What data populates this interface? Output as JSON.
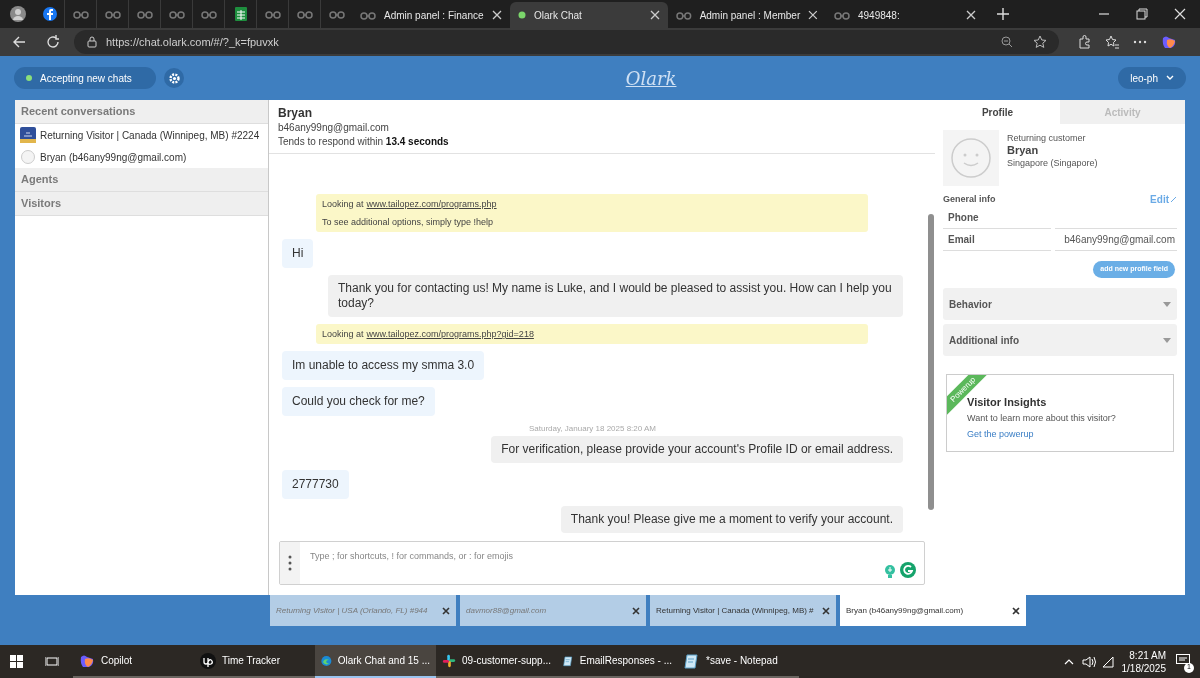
{
  "browser": {
    "tabs": [
      {
        "kind": "icon",
        "selected": false
      },
      {
        "kind": "icon",
        "selected": false
      },
      {
        "kind": "icon",
        "selected": false
      },
      {
        "kind": "icon",
        "selected": false
      },
      {
        "kind": "icon",
        "selected": false
      },
      {
        "kind": "icon",
        "selected": false
      },
      {
        "kind": "icon",
        "selected": false
      },
      {
        "kind": "icon",
        "selected": false
      },
      {
        "kind": "icon",
        "selected": false
      },
      {
        "kind": "icon",
        "selected": false
      },
      {
        "kind": "icon",
        "selected": false
      },
      {
        "kind": "text",
        "title": "Admin panel : Finance",
        "selected": false
      },
      {
        "kind": "text",
        "title": "Olark Chat",
        "selected": true
      },
      {
        "kind": "text",
        "title": "Admin panel : Member",
        "selected": false
      },
      {
        "kind": "text",
        "title": "4949848:",
        "selected": false
      }
    ],
    "url": "https://chat.olark.com/#/?_k=fpuvxk"
  },
  "header": {
    "status": "Accepting new chats",
    "logo": "Olark",
    "user": "leo-ph"
  },
  "sidebar": {
    "sections": [
      {
        "title": "Recent conversations",
        "items": [
          {
            "label": "Returning Visitor | Canada (Winnipeg, MB) #2224",
            "kind": "visitor"
          },
          {
            "label": "Bryan (b46any99ng@gmail.com)",
            "kind": "contact"
          }
        ]
      },
      {
        "title": "Agents"
      },
      {
        "title": "Visitors"
      }
    ]
  },
  "conversation": {
    "name": "Bryan",
    "email": "b46any99ng@gmail.com",
    "response_text": "Tends to respond within",
    "response_time": "13.4 seconds",
    "messages": [
      {
        "kind": "system",
        "lines": [
          {
            "text": "Looking at",
            "link": "www.tailopez.com/programs.php"
          },
          {
            "text": "To see additional options, simply type !help"
          }
        ]
      },
      {
        "kind": "visitor",
        "text": "Hi"
      },
      {
        "kind": "agent",
        "text": "Thank you for contacting us! My name is Luke, and I would be pleased to assist you. How can I help you today?"
      },
      {
        "kind": "system",
        "lines": [
          {
            "text": "Looking at",
            "link": "www.tailopez.com/programs.php?gid=218"
          }
        ]
      },
      {
        "kind": "visitor",
        "text": "Im unable to access my smma 3.0"
      },
      {
        "kind": "visitor",
        "text": "Could you check for me?"
      },
      {
        "kind": "timestamp",
        "text": "Saturday, January 18 2025 8:20 AM"
      },
      {
        "kind": "agent",
        "text": "For verification, please provide your account's Profile ID or email address."
      },
      {
        "kind": "visitor",
        "text": "2777730"
      },
      {
        "kind": "agent",
        "text": "Thank you! Please give me a moment to verify your account."
      }
    ],
    "composer": {
      "placeholder": "Type ; for shortcuts, ! for commands, or : for emojis"
    }
  },
  "profile": {
    "tabs": [
      {
        "label": "Profile",
        "selected": true
      },
      {
        "label": "Activity",
        "selected": false
      }
    ],
    "customer_type": "Returning customer",
    "name": "Bryan",
    "location": "Singapore (Singapore)",
    "general_info": "General info",
    "edit": "Edit",
    "fields": [
      {
        "label": "Phone"
      },
      {
        "label": "Email",
        "value": "b46any99ng@gmail.com"
      }
    ],
    "add_field": "add new profile field",
    "sections": [
      {
        "title": "Behavior",
        "expanded": false
      },
      {
        "title": "Additional info",
        "expanded": false
      }
    ],
    "powerup": {
      "ribbon": "Powerup",
      "title": "Visitor Insights",
      "text": "Want to learn more about this visitor?",
      "link": "Get the powerup"
    }
  },
  "chat_tabs": [
    {
      "label": "Returning Visitor | USA (Orlando, FL) #944",
      "selected": false,
      "italic": true
    },
    {
      "label": "davmor88@gmail.com",
      "selected": false,
      "italic": true
    },
    {
      "label": "Returning Visitor | Canada (Winnipeg, MB) #",
      "selected": false,
      "italic": false
    },
    {
      "label": "Bryan (b46any99ng@gmail.com)",
      "selected": true,
      "italic": false
    }
  ],
  "taskbar": {
    "items": [
      {
        "label": "Copilot",
        "selected": false
      },
      {
        "label": "Time Tracker",
        "selected": false
      },
      {
        "label": "Olark Chat and 15 ...",
        "selected": true
      },
      {
        "label": "09-customer-supp...",
        "selected": false
      },
      {
        "label": "EmailResponses - ...",
        "selected": false
      },
      {
        "label": "*save - Notepad",
        "selected": false
      }
    ],
    "time": "8:21 AM",
    "date": "1/18/2025",
    "notifications": "1"
  }
}
